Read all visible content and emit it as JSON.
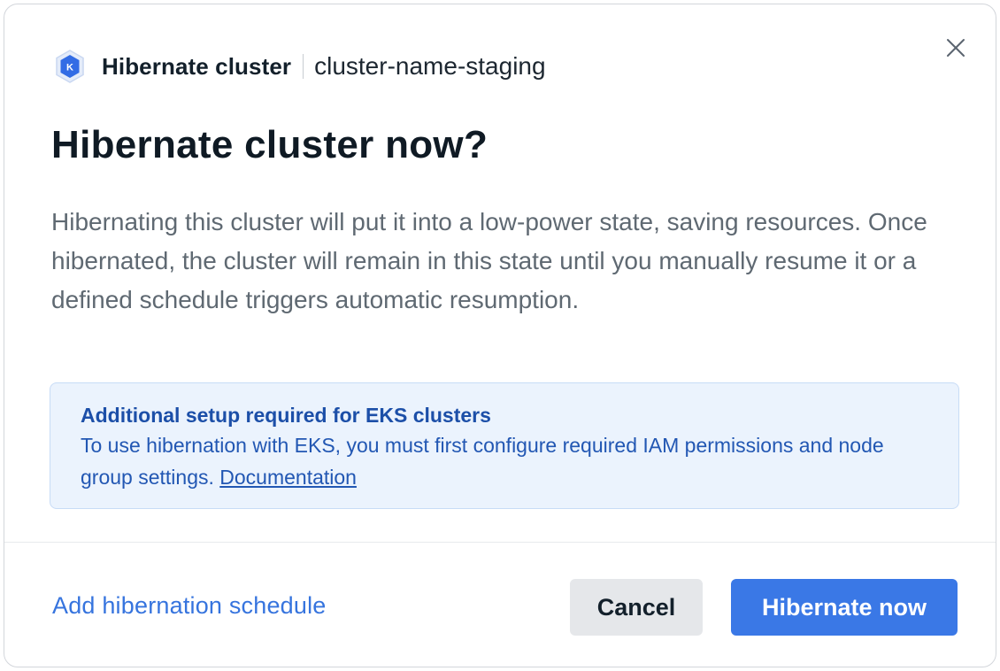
{
  "header": {
    "icon": "kubernetes-icon",
    "title": "Hibernate cluster",
    "cluster_name": "cluster-name-staging",
    "close_icon": "close-icon"
  },
  "main": {
    "title": "Hibernate cluster now?",
    "description": "Hibernating this cluster will put it into a low-power state, saving resources. Once hibernated, the cluster will remain in this state until you manually resume it or a defined schedule triggers automatic resumption."
  },
  "notice": {
    "title": "Additional setup required for EKS clusters",
    "body": "To use hibernation with EKS, you must first configure required IAM permissions and node group settings. ",
    "link": "Documentation"
  },
  "footer": {
    "schedule_link": "Add hibernation schedule",
    "cancel_label": "Cancel",
    "confirm_label": "Hibernate now"
  },
  "colors": {
    "primary": "#3a78e6",
    "link": "#3674de",
    "notice_bg": "#ebf3fd",
    "notice_text": "#2257b3",
    "heading": "#0f1a24"
  }
}
